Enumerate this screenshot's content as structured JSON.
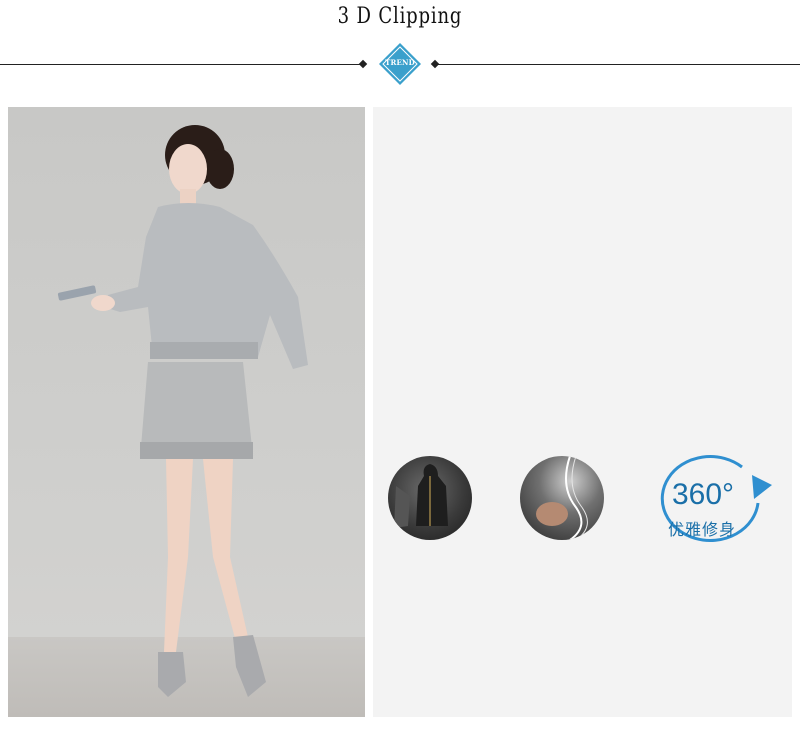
{
  "header": {
    "title": "3 D Clipping",
    "badge_text": "TREND",
    "badge_color": "#3aa0cc"
  },
  "left_photo": {
    "subject": "model-in-grey-knit-sweater-and-skirt"
  },
  "right_panel": {
    "feature_360_number": "360°",
    "feature_360_label": "优雅修身",
    "accent_color": "#1a6fa8",
    "arrow_color": "#2f8fd0"
  }
}
